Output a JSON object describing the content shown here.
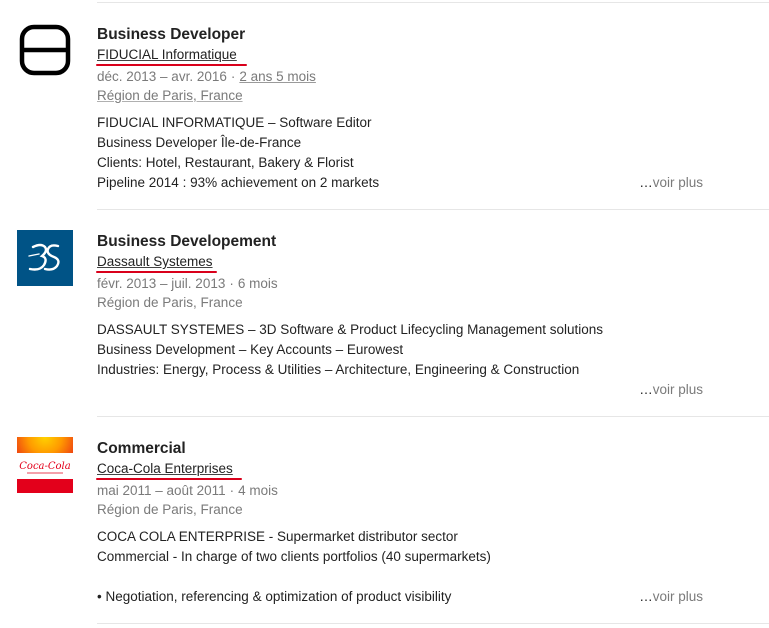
{
  "experiences": [
    {
      "title": "Business Developer",
      "company": "FIDUCIAL Informatique",
      "dates": "déc. 2013 – avr. 2016",
      "separator": "·",
      "duration": "2 ans 5 mois",
      "location": "Région de Paris, France",
      "description": [
        "FIDUCIAL INFORMATIQUE – Software Editor",
        "Business Developer Île-de-France",
        "Clients: Hotel, Restaurant, Bakery & Florist",
        "Pipeline 2014 : 93% achievement on 2 markets"
      ],
      "see_more_dots": "…",
      "see_more": "voir plus"
    },
    {
      "title": "Business Developement",
      "company": "Dassault Systemes",
      "dates": "févr. 2013 – juil. 2013",
      "separator": "·",
      "duration": "6 mois",
      "location": "Région de Paris, France",
      "description": [
        "DASSAULT SYSTEMES – 3D Software & Product Lifecycling Management solutions",
        "Business Development – Key Accounts – Eurowest",
        "Industries: Energy, Process & Utilities – Architecture, Engineering & Construction"
      ],
      "see_more_dots": "…",
      "see_more": "voir plus"
    },
    {
      "title": "Commercial",
      "company": "Coca-Cola Enterprises",
      "dates": "mai 2011 – août 2011",
      "separator": "·",
      "duration": "4 mois",
      "location": "Région de Paris, France",
      "description": [
        "COCA COLA ENTERPRISE - Supermarket distributor sector",
        "Commercial - In charge of two clients portfolios (40 supermarkets)",
        "",
        "• Negotiation, referencing & optimization of product visibility"
      ],
      "see_more_dots": "…",
      "see_more": "voir plus"
    }
  ],
  "logos": {
    "fiducial": {
      "icon": "fiducial-logo-icon",
      "color": "#000000"
    },
    "dassault": {
      "icon": "dassault-3ds-logo-icon",
      "text": "3S",
      "color": "#005386"
    },
    "cocacola": {
      "icon": "coca-cola-logo-icon",
      "text": "Coca-Cola",
      "color": "#e3001b"
    }
  },
  "colors": {
    "highlight": "#d9001b",
    "muted": "#7a7a7a",
    "text": "#222222"
  }
}
